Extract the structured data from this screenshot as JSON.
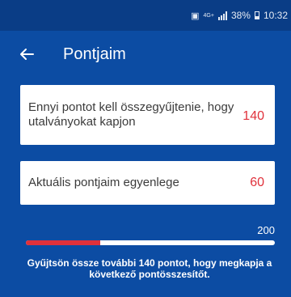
{
  "status_bar": {
    "network_type": "4G+",
    "battery_percent": "38%",
    "time": "10:32"
  },
  "header": {
    "title": "Pontjaim",
    "back_icon": "arrow-left-icon"
  },
  "target_card": {
    "label": "Ennyi pontot kell összegyűjtenie, hogy utalványokat kapjon",
    "value": "140"
  },
  "balance_card": {
    "label": "Aktuális pontjaim egyenlege",
    "value": "60"
  },
  "progress": {
    "current": 60,
    "max": 200,
    "max_label": "200",
    "message": "Gyűjtsön össze további 140 pontot, hogy megkapja a következő pontösszesítőt."
  },
  "colors": {
    "background": "#0c4ca3",
    "status_bar": "#0a3d86",
    "accent": "#e0313b",
    "card": "#ffffff"
  }
}
